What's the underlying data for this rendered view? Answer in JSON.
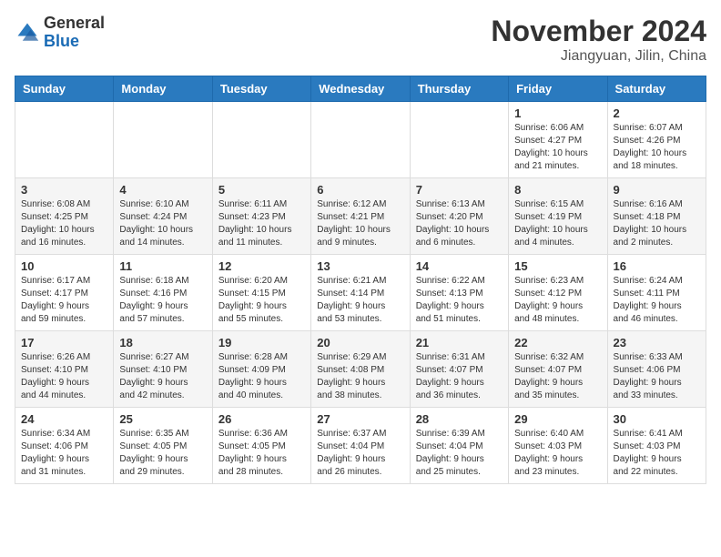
{
  "header": {
    "logo_general": "General",
    "logo_blue": "Blue",
    "month_title": "November 2024",
    "location": "Jiangyuan, Jilin, China"
  },
  "weekdays": [
    "Sunday",
    "Monday",
    "Tuesday",
    "Wednesday",
    "Thursday",
    "Friday",
    "Saturday"
  ],
  "weeks": [
    [
      {
        "day": "",
        "info": ""
      },
      {
        "day": "",
        "info": ""
      },
      {
        "day": "",
        "info": ""
      },
      {
        "day": "",
        "info": ""
      },
      {
        "day": "",
        "info": ""
      },
      {
        "day": "1",
        "info": "Sunrise: 6:06 AM\nSunset: 4:27 PM\nDaylight: 10 hours\nand 21 minutes."
      },
      {
        "day": "2",
        "info": "Sunrise: 6:07 AM\nSunset: 4:26 PM\nDaylight: 10 hours\nand 18 minutes."
      }
    ],
    [
      {
        "day": "3",
        "info": "Sunrise: 6:08 AM\nSunset: 4:25 PM\nDaylight: 10 hours\nand 16 minutes."
      },
      {
        "day": "4",
        "info": "Sunrise: 6:10 AM\nSunset: 4:24 PM\nDaylight: 10 hours\nand 14 minutes."
      },
      {
        "day": "5",
        "info": "Sunrise: 6:11 AM\nSunset: 4:23 PM\nDaylight: 10 hours\nand 11 minutes."
      },
      {
        "day": "6",
        "info": "Sunrise: 6:12 AM\nSunset: 4:21 PM\nDaylight: 10 hours\nand 9 minutes."
      },
      {
        "day": "7",
        "info": "Sunrise: 6:13 AM\nSunset: 4:20 PM\nDaylight: 10 hours\nand 6 minutes."
      },
      {
        "day": "8",
        "info": "Sunrise: 6:15 AM\nSunset: 4:19 PM\nDaylight: 10 hours\nand 4 minutes."
      },
      {
        "day": "9",
        "info": "Sunrise: 6:16 AM\nSunset: 4:18 PM\nDaylight: 10 hours\nand 2 minutes."
      }
    ],
    [
      {
        "day": "10",
        "info": "Sunrise: 6:17 AM\nSunset: 4:17 PM\nDaylight: 9 hours\nand 59 minutes."
      },
      {
        "day": "11",
        "info": "Sunrise: 6:18 AM\nSunset: 4:16 PM\nDaylight: 9 hours\nand 57 minutes."
      },
      {
        "day": "12",
        "info": "Sunrise: 6:20 AM\nSunset: 4:15 PM\nDaylight: 9 hours\nand 55 minutes."
      },
      {
        "day": "13",
        "info": "Sunrise: 6:21 AM\nSunset: 4:14 PM\nDaylight: 9 hours\nand 53 minutes."
      },
      {
        "day": "14",
        "info": "Sunrise: 6:22 AM\nSunset: 4:13 PM\nDaylight: 9 hours\nand 51 minutes."
      },
      {
        "day": "15",
        "info": "Sunrise: 6:23 AM\nSunset: 4:12 PM\nDaylight: 9 hours\nand 48 minutes."
      },
      {
        "day": "16",
        "info": "Sunrise: 6:24 AM\nSunset: 4:11 PM\nDaylight: 9 hours\nand 46 minutes."
      }
    ],
    [
      {
        "day": "17",
        "info": "Sunrise: 6:26 AM\nSunset: 4:10 PM\nDaylight: 9 hours\nand 44 minutes."
      },
      {
        "day": "18",
        "info": "Sunrise: 6:27 AM\nSunset: 4:10 PM\nDaylight: 9 hours\nand 42 minutes."
      },
      {
        "day": "19",
        "info": "Sunrise: 6:28 AM\nSunset: 4:09 PM\nDaylight: 9 hours\nand 40 minutes."
      },
      {
        "day": "20",
        "info": "Sunrise: 6:29 AM\nSunset: 4:08 PM\nDaylight: 9 hours\nand 38 minutes."
      },
      {
        "day": "21",
        "info": "Sunrise: 6:31 AM\nSunset: 4:07 PM\nDaylight: 9 hours\nand 36 minutes."
      },
      {
        "day": "22",
        "info": "Sunrise: 6:32 AM\nSunset: 4:07 PM\nDaylight: 9 hours\nand 35 minutes."
      },
      {
        "day": "23",
        "info": "Sunrise: 6:33 AM\nSunset: 4:06 PM\nDaylight: 9 hours\nand 33 minutes."
      }
    ],
    [
      {
        "day": "24",
        "info": "Sunrise: 6:34 AM\nSunset: 4:06 PM\nDaylight: 9 hours\nand 31 minutes."
      },
      {
        "day": "25",
        "info": "Sunrise: 6:35 AM\nSunset: 4:05 PM\nDaylight: 9 hours\nand 29 minutes."
      },
      {
        "day": "26",
        "info": "Sunrise: 6:36 AM\nSunset: 4:05 PM\nDaylight: 9 hours\nand 28 minutes."
      },
      {
        "day": "27",
        "info": "Sunrise: 6:37 AM\nSunset: 4:04 PM\nDaylight: 9 hours\nand 26 minutes."
      },
      {
        "day": "28",
        "info": "Sunrise: 6:39 AM\nSunset: 4:04 PM\nDaylight: 9 hours\nand 25 minutes."
      },
      {
        "day": "29",
        "info": "Sunrise: 6:40 AM\nSunset: 4:03 PM\nDaylight: 9 hours\nand 23 minutes."
      },
      {
        "day": "30",
        "info": "Sunrise: 6:41 AM\nSunset: 4:03 PM\nDaylight: 9 hours\nand 22 minutes."
      }
    ]
  ]
}
